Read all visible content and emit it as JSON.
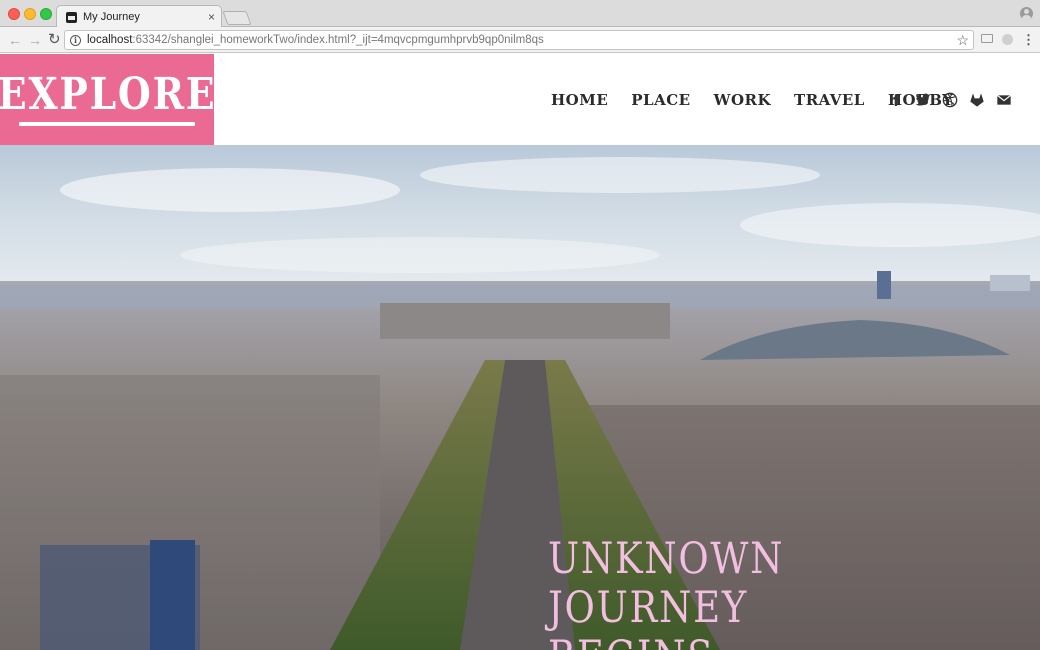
{
  "browser": {
    "tab_title": "My Journey",
    "tab_close": "×",
    "url_host": "localhost",
    "url_rest": ":63342/shanglei_homeworkTwo/index.html?_ijt=4mqvcpmgumhprvb9qp0nilm8qs",
    "back_glyph": "←",
    "forward_glyph": "→",
    "reload_glyph": "↻",
    "star_glyph": "☆",
    "menu_glyph": "⋮"
  },
  "site": {
    "logo": "EXPLORE",
    "nav": [
      "HOME",
      "PLACE",
      "WORK",
      "TRAVEL",
      "HOBBY"
    ],
    "social_icons": [
      "facebook-icon",
      "twitter-icon",
      "dribbble-icon",
      "gitlab-icon",
      "envelope-icon"
    ],
    "facebook_glyph": "f"
  },
  "hero": {
    "headline_lines": [
      "UNKNOWN",
      "JOURNEY",
      "BEGINS."
    ],
    "accent_color": "#ea6a93",
    "headline_color": "#f3bfe0"
  }
}
